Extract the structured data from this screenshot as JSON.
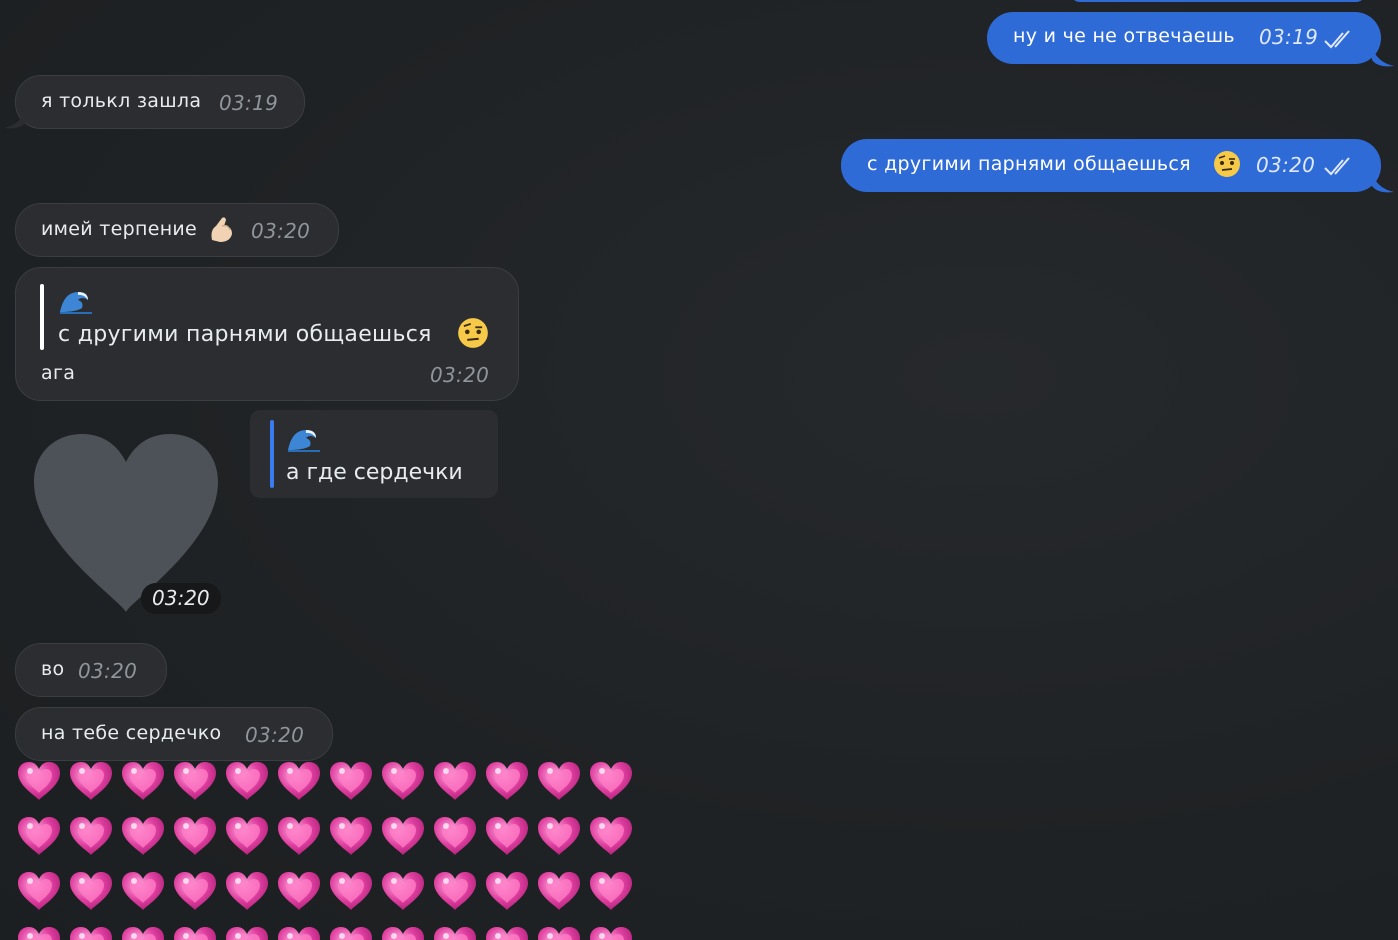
{
  "messages": {
    "m1": {
      "text": "ну и че не отвечаешь",
      "time": "03:19"
    },
    "m2": {
      "text": "я толькл зашла",
      "time": "03:19"
    },
    "m3": {
      "text": "с другими парнями общаешься",
      "time": "03:20"
    },
    "m4": {
      "text": "имей терпение",
      "time": "03:20"
    },
    "m5": {
      "quote_text": "с другими парнями общаешься",
      "text": "ага",
      "time": "03:20"
    },
    "m6": {
      "quote_text": "а где сердечки",
      "sticker": "heart-sticker",
      "time": "03:20"
    },
    "m7": {
      "text": "во",
      "time": "03:20"
    },
    "m8": {
      "text": "на тебе сердечко",
      "time": "03:20"
    }
  },
  "icons": {
    "read_status": "double-check-icon",
    "quote_author": "wave-emoji-icon",
    "sticker_heart": "heart-sticker",
    "hearts": "sparkling-heart-emoji"
  },
  "colors": {
    "background": "#1f2224",
    "incoming_bubble": "#2b2d30",
    "outgoing_bubble": "#2f6bd6",
    "sticker": "#4d5258",
    "heart_emoji": "#e040a0"
  },
  "hearts_emoji": {
    "columns": 12,
    "rows": 4
  }
}
